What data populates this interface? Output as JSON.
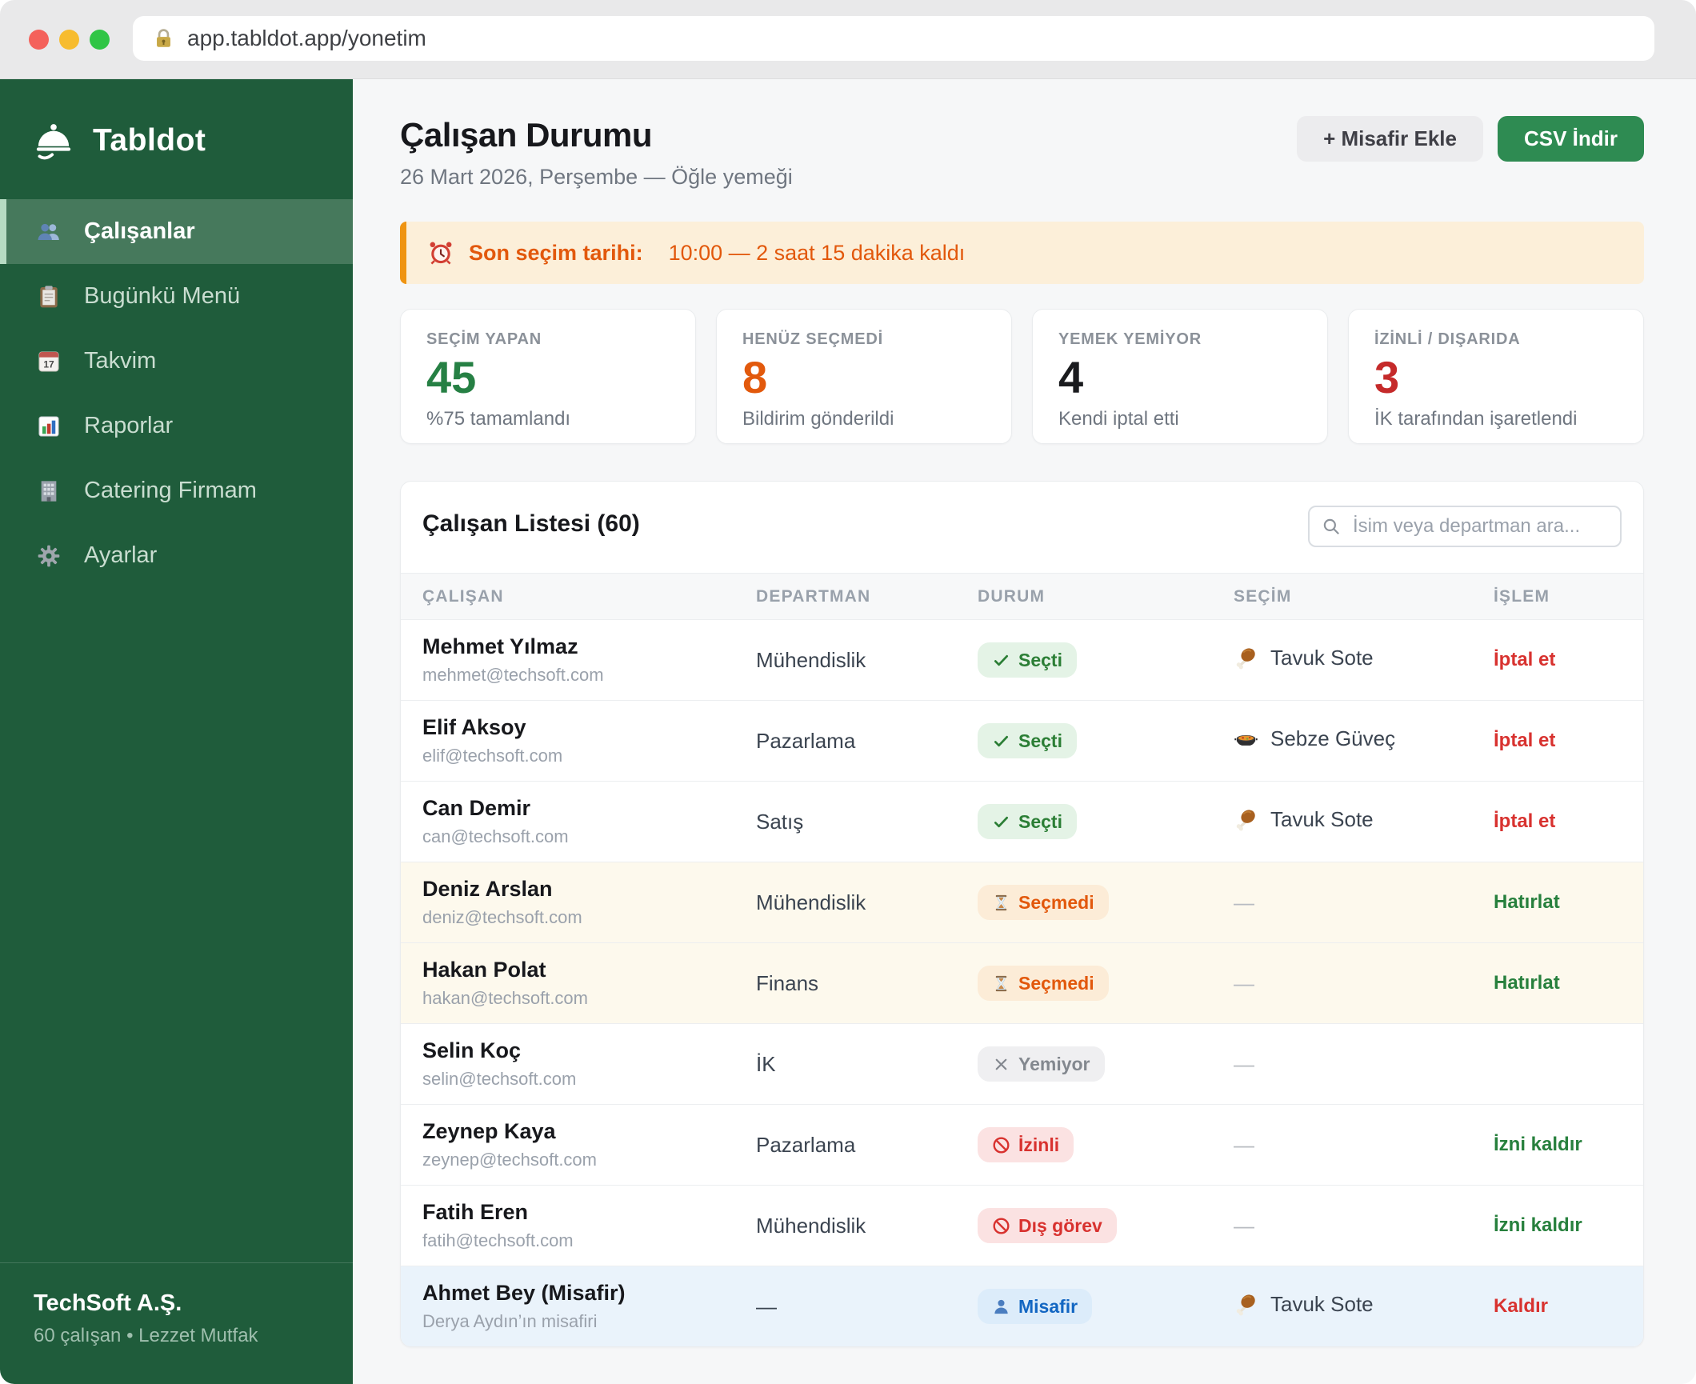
{
  "browser": {
    "url": "app.tabldot.app/yonetim"
  },
  "sidebar": {
    "logo_text": "Tabldot",
    "items": [
      {
        "label": "Çalışanlar",
        "icon": "users-icon",
        "active": true
      },
      {
        "label": "Bugünkü Menü",
        "icon": "clipboard-icon"
      },
      {
        "label": "Takvim",
        "icon": "calendar-icon"
      },
      {
        "label": "Raporlar",
        "icon": "chart-icon"
      },
      {
        "label": "Catering Firmam",
        "icon": "building-icon"
      },
      {
        "label": "Ayarlar",
        "icon": "gear-icon"
      }
    ],
    "footer": {
      "company": "TechSoft A.Ş.",
      "meta": "60 çalışan • Lezzet Mutfak"
    }
  },
  "header": {
    "title": "Çalışan Durumu",
    "subtitle": "26 Mart 2026, Perşembe — Öğle yemeği",
    "add_guest_label": "+ Misafir Ekle",
    "csv_label": "CSV İndir"
  },
  "alert": {
    "label": "Son seçim tarihi:",
    "text": "10:00 — 2 saat 15 dakika kaldı"
  },
  "stats": [
    {
      "label": "SEÇİM YAPAN",
      "value": "45",
      "sub": "%75 tamamlandı",
      "color": "#268044"
    },
    {
      "label": "HENÜZ SEÇMEDİ",
      "value": "8",
      "sub": "Bildirim gönderildi",
      "color": "#e2590c"
    },
    {
      "label": "YEMEK YEMİYOR",
      "value": "4",
      "sub": "Kendi iptal etti",
      "color": "#1a1b1e"
    },
    {
      "label": "İZİNLİ / DIŞARIDA",
      "value": "3",
      "sub": "İK tarafından işaretlendi",
      "color": "#c52a2a"
    }
  ],
  "table": {
    "title": "Çalışan Listesi (60)",
    "search_placeholder": "İsim veya departman ara...",
    "none_placeholder": "—",
    "columns": [
      "ÇALIŞAN",
      "DEPARTMAN",
      "DURUM",
      "SEÇİM",
      "İŞLEM"
    ],
    "rows": [
      {
        "name": "Mehmet Yılmaz",
        "sub": "mehmet@techsoft.com",
        "department": "Mühendislik",
        "status": {
          "type": "selected",
          "icon": "check-icon",
          "label": "Seçti"
        },
        "choice": {
          "icon": "chicken-icon",
          "label": "Tavuk Sote"
        },
        "action": {
          "type": "danger",
          "label": "İptal et"
        }
      },
      {
        "name": "Elif Aksoy",
        "sub": "elif@techsoft.com",
        "department": "Pazarlama",
        "status": {
          "type": "selected",
          "icon": "check-icon",
          "label": "Seçti"
        },
        "choice": {
          "icon": "stew-icon",
          "label": "Sebze Güveç"
        },
        "action": {
          "type": "danger",
          "label": "İptal et"
        }
      },
      {
        "name": "Can Demir",
        "sub": "can@techsoft.com",
        "department": "Satış",
        "status": {
          "type": "selected",
          "icon": "check-icon",
          "label": "Seçti"
        },
        "choice": {
          "icon": "chicken-icon",
          "label": "Tavuk Sote"
        },
        "action": {
          "type": "danger",
          "label": "İptal et"
        }
      },
      {
        "name": "Deniz Arslan",
        "sub": "deniz@techsoft.com",
        "department": "Mühendislik",
        "highlight": "pending",
        "status": {
          "type": "pending",
          "icon": "hourglass-icon",
          "label": "Seçmedi"
        },
        "action": {
          "type": "positive",
          "label": "Hatırlat"
        }
      },
      {
        "name": "Hakan Polat",
        "sub": "hakan@techsoft.com",
        "department": "Finans",
        "highlight": "pending",
        "status": {
          "type": "pending",
          "icon": "hourglass-icon",
          "label": "Seçmedi"
        },
        "action": {
          "type": "positive",
          "label": "Hatırlat"
        }
      },
      {
        "name": "Selin Koç",
        "sub": "selin@techsoft.com",
        "department": "İK",
        "status": {
          "type": "none",
          "icon": "x-icon",
          "label": "Yemiyor"
        }
      },
      {
        "name": "Zeynep Kaya",
        "sub": "zeynep@techsoft.com",
        "department": "Pazarlama",
        "status": {
          "type": "blocked",
          "icon": "no-entry-icon",
          "label": "İzinli"
        },
        "action": {
          "type": "positive",
          "label": "İzni kaldır"
        }
      },
      {
        "name": "Fatih Eren",
        "sub": "fatih@techsoft.com",
        "department": "Mühendislik",
        "status": {
          "type": "blocked",
          "icon": "no-entry-icon",
          "label": "Dış görev"
        },
        "action": {
          "type": "positive",
          "label": "İzni kaldır"
        }
      },
      {
        "name": "Ahmet Bey (Misafir)",
        "sub": "Derya Aydın’ın misafiri",
        "department": "—",
        "highlight": "guest",
        "status": {
          "type": "guest",
          "icon": "bust-icon",
          "label": "Misafir"
        },
        "choice": {
          "icon": "chicken-icon",
          "label": "Tavuk Sote"
        },
        "action": {
          "type": "danger",
          "label": "Kaldır"
        }
      }
    ]
  }
}
